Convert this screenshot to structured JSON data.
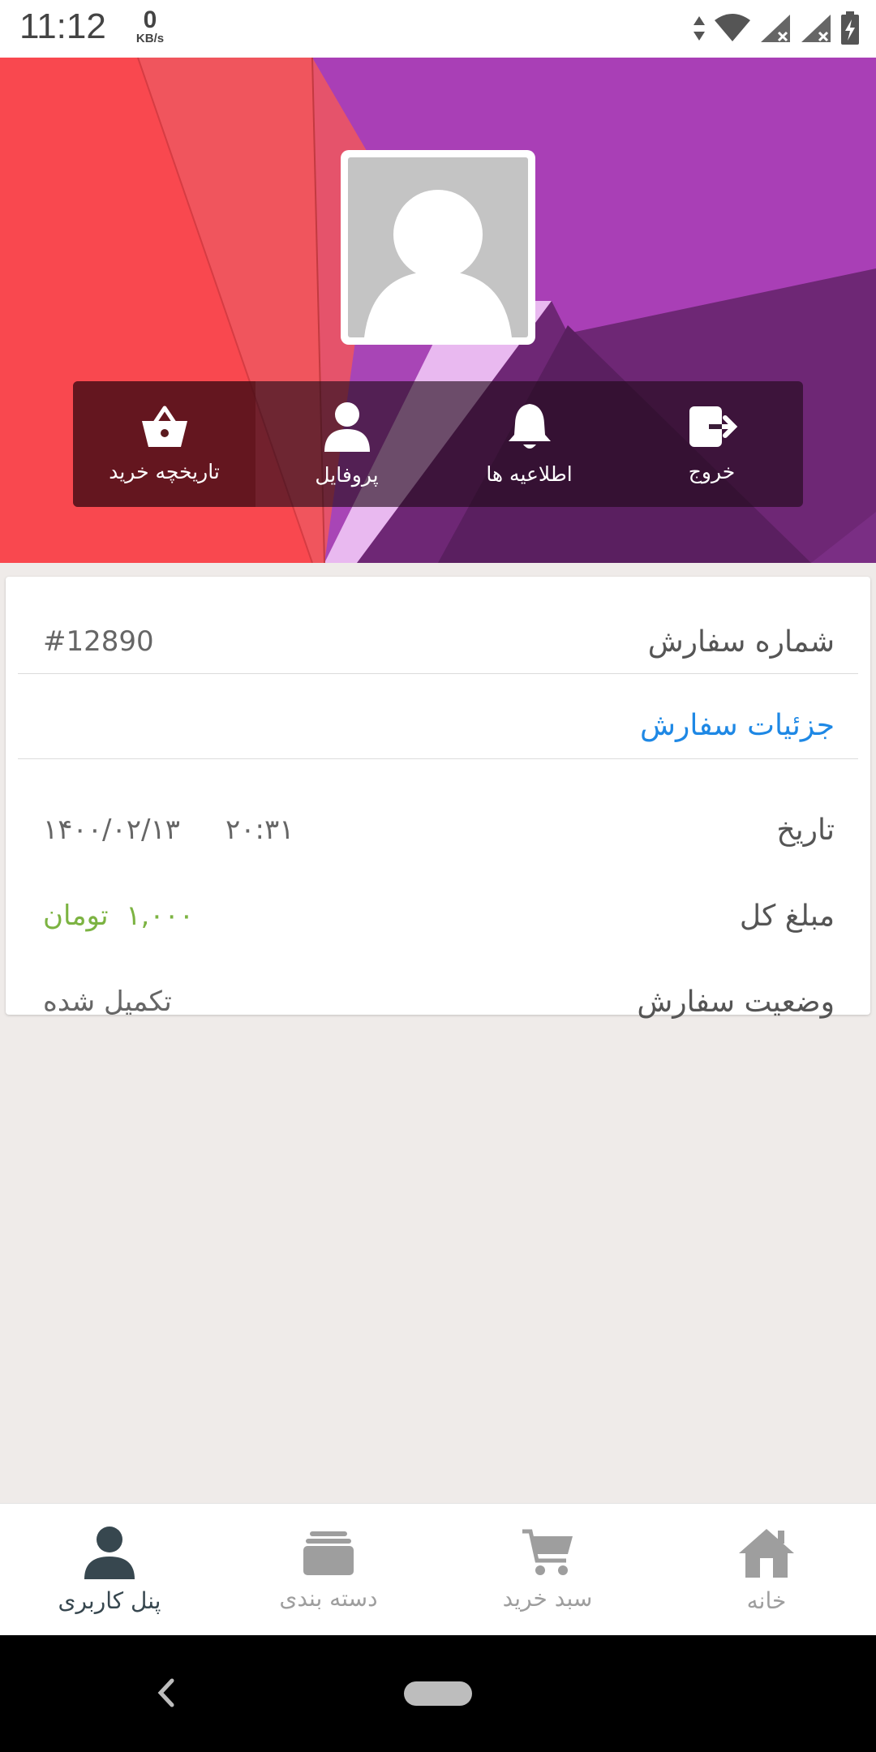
{
  "status_bar": {
    "time": "11:12",
    "speed_value": "0",
    "speed_unit": "KB/s",
    "icons": [
      "data-arrows-icon",
      "wifi-icon",
      "signal-x-icon",
      "signal-x-icon",
      "battery-charging-icon"
    ]
  },
  "header": {
    "avatar_icon": "user-placeholder-icon",
    "actions": [
      {
        "label": "خروج",
        "icon": "logout-icon"
      },
      {
        "label": "اطلاعیه ها",
        "icon": "bell-icon"
      },
      {
        "label": "پروفایل",
        "icon": "person-icon"
      },
      {
        "label": "تاریخچه خرید",
        "icon": "basket-icon"
      }
    ]
  },
  "order": {
    "number_label": "شماره سفارش",
    "number_value": "#12890",
    "details_link": "جزئیات سفارش",
    "date_label": "تاریخ",
    "date_value": "۱۴۰۰/۰۲/۱۳",
    "time_value": "۲۰:۳۱",
    "total_label": "مبلغ کل",
    "total_value": "۱,۰۰۰  تومان",
    "status_label": "وضعیت سفارش",
    "status_value": "تکمیل شده"
  },
  "bottom_nav": {
    "items": [
      {
        "label": "خانه",
        "icon": "home-icon",
        "active": false
      },
      {
        "label": "سبد خرید",
        "icon": "cart-icon",
        "active": false
      },
      {
        "label": "دسته بندی",
        "icon": "stack-icon",
        "active": false
      },
      {
        "label": "پنل کاربری",
        "icon": "user-icon",
        "active": true
      }
    ]
  },
  "colors": {
    "accent_link": "#1e88e5",
    "price_green": "#7cb342",
    "active_nav": "#37474f",
    "inactive_nav": "#9e9e9e"
  }
}
